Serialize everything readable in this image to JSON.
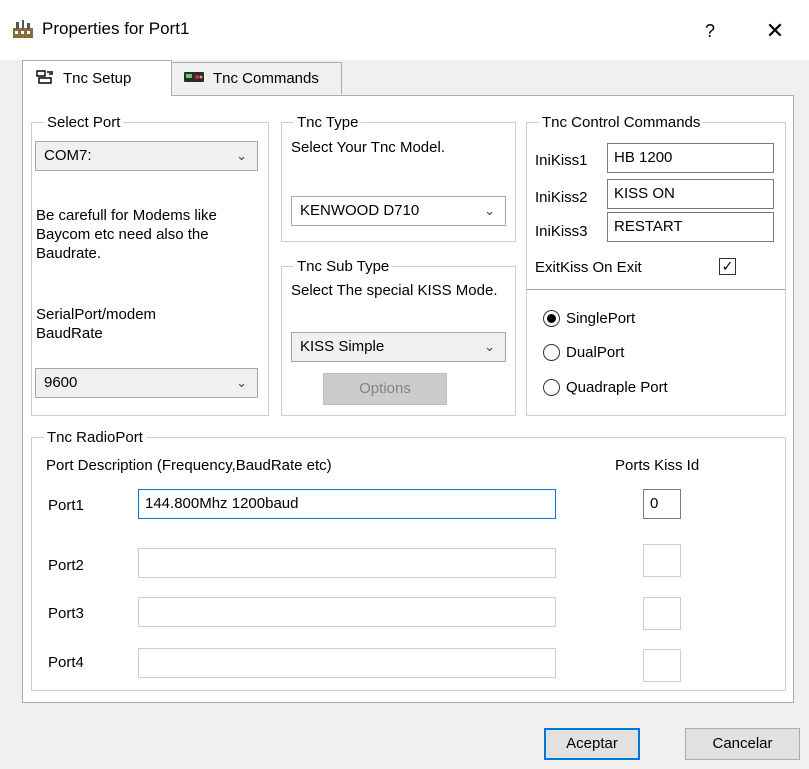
{
  "window": {
    "title": "Properties for Port1",
    "help": "?",
    "close": "✕"
  },
  "tabs": [
    {
      "label": "Tnc Setup",
      "icon": "tnc-setup-icon"
    },
    {
      "label": "Tnc Commands",
      "icon": "radio-device-icon"
    }
  ],
  "select_port": {
    "legend": "Select Port",
    "port_value": "COM7:",
    "note": "Be carefull for Modems like Baycom etc need also the Baudrate.",
    "baud_label": "SerialPort/modem BaudRate",
    "baud_value": "9600"
  },
  "tnc_type": {
    "legend": "Tnc Type",
    "prompt": "Select Your Tnc Model.",
    "value": "KENWOOD D710"
  },
  "tnc_sub_type": {
    "legend": "Tnc Sub Type",
    "prompt": "Select The special KISS Mode.",
    "value": "KISS Simple",
    "options_label": "Options"
  },
  "tnc_control": {
    "legend": "Tnc Control Commands",
    "inikiss": [
      {
        "label": "IniKiss1",
        "value": "HB 1200"
      },
      {
        "label": "IniKiss2",
        "value": "KISS ON"
      },
      {
        "label": "IniKiss3",
        "value": "RESTART"
      }
    ],
    "exit_kiss_label": "ExitKiss On Exit",
    "exit_kiss_checked": true,
    "port_modes": [
      {
        "label": "SinglePort",
        "selected": true
      },
      {
        "label": "DualPort",
        "selected": false
      },
      {
        "label": "Quadraple Port",
        "selected": false
      }
    ]
  },
  "radio_port": {
    "legend": "Tnc RadioPort",
    "desc_header": "Port Description (Frequency,BaudRate etc)",
    "kiss_header": "Ports Kiss Id",
    "ports": [
      {
        "label": "Port1",
        "description": "144.800Mhz 1200baud",
        "kiss_id": "0"
      },
      {
        "label": "Port2",
        "description": "",
        "kiss_id": ""
      },
      {
        "label": "Port3",
        "description": "",
        "kiss_id": ""
      },
      {
        "label": "Port4",
        "description": "",
        "kiss_id": ""
      }
    ]
  },
  "footer": {
    "accept_label": "Aceptar",
    "cancel_label": "Cancelar"
  },
  "colors": {
    "focus_border": "#0078d7",
    "dialog_bg": "#f0f0f0"
  }
}
